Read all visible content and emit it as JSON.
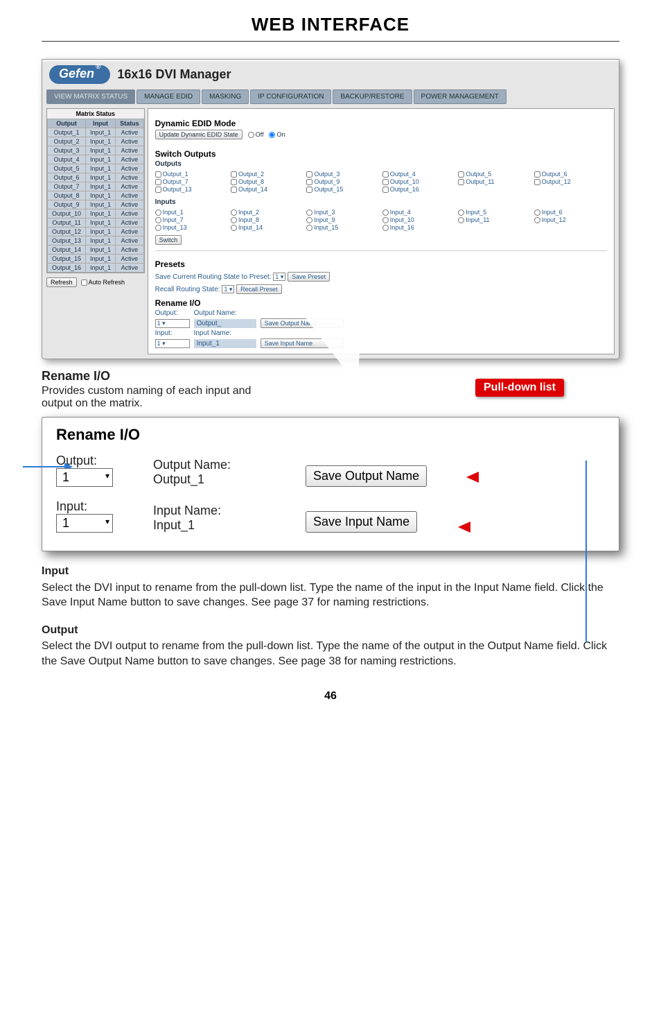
{
  "pageTitle": "WEB INTERFACE",
  "pageNumber": "46",
  "app": {
    "logo": "Gefen",
    "title": "16x16 DVI Manager",
    "tabs": [
      "VIEW MATRIX STATUS",
      "MANAGE EDID",
      "MASKING",
      "IP CONFIGURATION",
      "BACKUP/RESTORE",
      "POWER MANAGEMENT"
    ]
  },
  "matrixStatus": {
    "title": "Matrix Status",
    "headers": [
      "Output",
      "Input",
      "Status"
    ],
    "rows": [
      [
        "Output_1",
        "Input_1",
        "Active"
      ],
      [
        "Output_2",
        "Input_1",
        "Active"
      ],
      [
        "Output_3",
        "Input_1",
        "Active"
      ],
      [
        "Output_4",
        "Input_1",
        "Active"
      ],
      [
        "Output_5",
        "Input_1",
        "Active"
      ],
      [
        "Output_6",
        "Input_1",
        "Active"
      ],
      [
        "Output_7",
        "Input_1",
        "Active"
      ],
      [
        "Output_8",
        "Input_1",
        "Active"
      ],
      [
        "Output_9",
        "Input_1",
        "Active"
      ],
      [
        "Output_10",
        "Input_1",
        "Active"
      ],
      [
        "Output_11",
        "Input_1",
        "Active"
      ],
      [
        "Output_12",
        "Input_1",
        "Active"
      ],
      [
        "Output_13",
        "Input_1",
        "Active"
      ],
      [
        "Output_14",
        "Input_1",
        "Active"
      ],
      [
        "Output_15",
        "Input_1",
        "Active"
      ],
      [
        "Output_16",
        "Input_1",
        "Active"
      ]
    ],
    "refresh": "Refresh",
    "autoRefresh": "Auto Refresh"
  },
  "main": {
    "dynamicEdidTitle": "Dynamic EDID Mode",
    "updateBtn": "Update Dynamic EDID State",
    "off": "Off",
    "on": "On",
    "switchOutputsTitle": "Switch Outputs",
    "outputsLabel": "Outputs",
    "outputs": [
      "Output_1",
      "Output_2",
      "Output_3",
      "Output_4",
      "Output_5",
      "Output_6",
      "Output_7",
      "Output_8",
      "Output_9",
      "Output_10",
      "Output_11",
      "Output_12",
      "Output_13",
      "Output_14",
      "Output_15",
      "Output_16"
    ],
    "inputsLabel": "Inputs",
    "inputs": [
      "Input_1",
      "Input_2",
      "Input_3",
      "Input_4",
      "Input_5",
      "Input_6",
      "Input_7",
      "Input_8",
      "Input_9",
      "Input_10",
      "Input_11",
      "Input_12",
      "Input_13",
      "Input_14",
      "Input_15",
      "Input_16"
    ],
    "switchBtn": "Switch",
    "presets": {
      "title": "Presets",
      "saveLabel": "Save Current Routing State to Preset:",
      "saveSelect": "1",
      "saveBtn": "Save Preset",
      "recallLabel": "Recall Routing State:",
      "recallSelect": "1",
      "recallBtn": "Recall Preset"
    },
    "renameIO": {
      "title": "Rename I/O",
      "outputLabel": "Output:",
      "outputNameLabel": "Output Name:",
      "outputSelect": "1",
      "outputValue": "Output_",
      "saveOutputBtn": "Save Output Name",
      "inputLabel": "Input:",
      "inputNameLabel": "Input Name:",
      "inputSelect": "1",
      "inputValue": "Input_1",
      "saveInputBtn": "Save Input Name"
    }
  },
  "callouts": {
    "renameHeading": "Rename I/O",
    "renameDesc": "Provides custom naming of each input and output on the matrix.",
    "pullDown": "Pull-down list"
  },
  "zoom": {
    "title": "Rename I/O",
    "outputLabel": "Output:",
    "outputNameLabel": "Output Name:",
    "outputSelect": "1",
    "outputValue": "Output_1",
    "saveOutputBtn": "Save Output Name",
    "inputLabel": "Input:",
    "inputNameLabel": "Input Name:",
    "inputSelect": "1",
    "inputValue": "Input_1",
    "saveInputBtn": "Save Input Name"
  },
  "bodyText": {
    "inputHeading": "Input",
    "inputText": "Select the DVI input to rename from the pull-down list.  Type the name of the input in the Input Name field.  Click the Save Input Name button to save changes.  See page 37 for naming restrictions.",
    "outputHeading": "Output",
    "outputText": "Select the DVI output to rename from the pull-down list.  Type the name of the output in the Output Name field.  Click the Save Output Name button to save changes.  See page 38 for naming restrictions."
  }
}
